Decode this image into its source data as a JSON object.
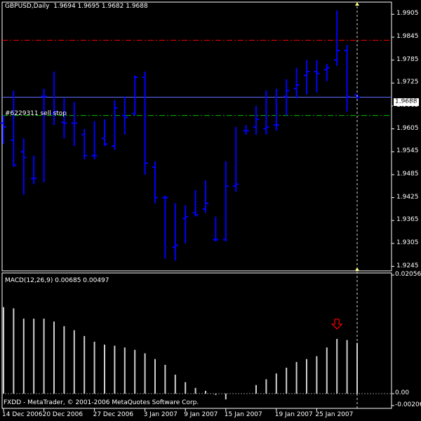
{
  "window": {
    "symbol_label": "GBPUSD,Daily",
    "ohlc_label": "1.9694 1.9695 1.9682 1.9688",
    "current_price_tag": "1.9688",
    "order_label": "#6229311 sell stop",
    "copyright": "FXDD - MetaTrader, © 2001-2006 MetaQuotes Software Corp."
  },
  "colors": {
    "background": "#000000",
    "bars": "#0000ff",
    "grid": "#ffffff",
    "red_line": "#ff0000",
    "green_line": "#00c000",
    "price_line": "#5a6cff",
    "histogram": "#d0d0d0",
    "arrow": "#ff0000"
  },
  "chart_data": [
    {
      "type": "ohlc",
      "title": "GBPUSD,Daily",
      "y_ticks": [
        "1.9905",
        "1.9845",
        "1.9785",
        "1.9725",
        "1.9665",
        "1.9605",
        "1.9545",
        "1.9485",
        "1.9425",
        "1.9365",
        "1.9305",
        "1.9245"
      ],
      "ylim": [
        1.9235,
        1.9935
      ],
      "current_price": 1.9688,
      "red_level": 1.9837,
      "green_level": 1.964,
      "x_ticks": [
        "14 Dec 2006",
        "20 Dec 2006",
        "27 Dec 2006",
        "3 Jan 2007",
        "9 Jan 2007",
        "15 Jan 2007",
        "19 Jan 2007",
        "25 Jan 2007"
      ],
      "bars": [
        {
          "open": 1.962,
          "high": 1.964,
          "low": 1.9565,
          "close": 1.961
        },
        {
          "open": 1.9575,
          "high": 1.9705,
          "low": 1.9505,
          "close": 1.951
        },
        {
          "open": 1.9545,
          "high": 1.958,
          "low": 1.9432,
          "close": 1.953
        },
        {
          "open": 1.9475,
          "high": 1.9535,
          "low": 1.946,
          "close": 1.9475
        },
        {
          "open": 1.969,
          "high": 1.971,
          "low": 1.9465,
          "close": 1.969
        },
        {
          "open": 1.9645,
          "high": 1.9755,
          "low": 1.9615,
          "close": 1.965
        },
        {
          "open": 1.9622,
          "high": 1.9685,
          "low": 1.958,
          "close": 1.962
        },
        {
          "open": 1.962,
          "high": 1.9675,
          "low": 1.956,
          "close": 1.962
        },
        {
          "open": 1.959,
          "high": 1.9605,
          "low": 1.9525,
          "close": 1.9535
        },
        {
          "open": 1.9535,
          "high": 1.9625,
          "low": 1.9525,
          "close": 1.9535
        },
        {
          "open": 1.958,
          "high": 1.963,
          "low": 1.956,
          "close": 1.9565
        },
        {
          "open": 1.956,
          "high": 1.968,
          "low": 1.955,
          "close": 1.966
        },
        {
          "open": 1.964,
          "high": 1.969,
          "low": 1.959,
          "close": 1.9635
        },
        {
          "open": 1.9645,
          "high": 1.9745,
          "low": 1.964,
          "close": 1.974
        },
        {
          "open": 1.974,
          "high": 1.9755,
          "low": 1.9485,
          "close": 1.9515
        },
        {
          "open": 1.9505,
          "high": 1.952,
          "low": 1.941,
          "close": 1.9425
        },
        {
          "open": 1.9425,
          "high": 1.943,
          "low": 1.9265,
          "close": 1.9425
        },
        {
          "open": 1.9295,
          "high": 1.941,
          "low": 1.926,
          "close": 1.93
        },
        {
          "open": 1.937,
          "high": 1.9405,
          "low": 1.9305,
          "close": 1.9375
        },
        {
          "open": 1.9385,
          "high": 1.9445,
          "low": 1.9375,
          "close": 1.938
        },
        {
          "open": 1.9395,
          "high": 1.947,
          "low": 1.9385,
          "close": 1.941
        },
        {
          "open": 1.9315,
          "high": 1.9375,
          "low": 1.931,
          "close": 1.9315
        },
        {
          "open": 1.9315,
          "high": 1.952,
          "low": 1.931,
          "close": 1.9455
        },
        {
          "open": 1.9455,
          "high": 1.961,
          "low": 1.944,
          "close": 1.946
        },
        {
          "open": 1.96,
          "high": 1.9615,
          "low": 1.959,
          "close": 1.96
        },
        {
          "open": 1.961,
          "high": 1.9665,
          "low": 1.959,
          "close": 1.963
        },
        {
          "open": 1.9605,
          "high": 1.9705,
          "low": 1.959,
          "close": 1.961
        },
        {
          "open": 1.9615,
          "high": 1.971,
          "low": 1.96,
          "close": 1.9615
        },
        {
          "open": 1.969,
          "high": 1.9735,
          "low": 1.964,
          "close": 1.9705
        },
        {
          "open": 1.971,
          "high": 1.9765,
          "low": 1.9685,
          "close": 1.972
        },
        {
          "open": 1.9745,
          "high": 1.9785,
          "low": 1.9695,
          "close": 1.9755
        },
        {
          "open": 1.9755,
          "high": 1.9785,
          "low": 1.97,
          "close": 1.975
        },
        {
          "open": 1.976,
          "high": 1.9775,
          "low": 1.973,
          "close": 1.9765
        },
        {
          "open": 1.9785,
          "high": 1.9915,
          "low": 1.977,
          "close": 1.981
        },
        {
          "open": 1.981,
          "high": 1.9825,
          "low": 1.965,
          "close": 1.969
        },
        {
          "open": 1.9694,
          "high": 1.9695,
          "low": 1.9682,
          "close": 1.9688
        }
      ]
    },
    {
      "type": "bar",
      "title": "MACD(12,26,9) 0.00685 0.00497",
      "y_ticks": [
        "0.02056",
        "0.00",
        "-0.00206"
      ],
      "ylim": [
        -0.00206,
        0.02056
      ],
      "values": [
        0.015,
        0.0148,
        0.013,
        0.013,
        0.013,
        0.0125,
        0.0117,
        0.011,
        0.01,
        0.009,
        0.0085,
        0.0083,
        0.008,
        0.0076,
        0.007,
        0.006,
        0.005,
        0.0033,
        0.002,
        0.001,
        0.0005,
        -0.0002,
        -0.001,
        0.0,
        0.0,
        0.0015,
        0.0025,
        0.0035,
        0.0045,
        0.0055,
        0.006,
        0.0065,
        0.008,
        0.0095,
        0.0093,
        0.0088
      ]
    }
  ]
}
